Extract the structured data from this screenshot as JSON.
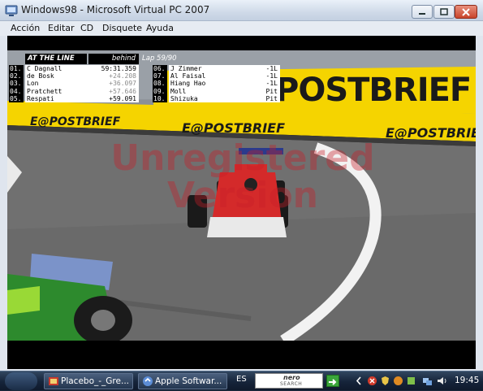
{
  "window": {
    "title": "Windows98 - Microsoft Virtual PC 2007",
    "menu": [
      "Acción",
      "Editar",
      "CD",
      "Disquete",
      "Ayuda"
    ]
  },
  "hud": {
    "header": "AT THE LINE",
    "behind_label": "behind",
    "lap": "Lap 59/90",
    "left_rows": [
      {
        "pos": "01.",
        "name": "C Dagnall",
        "gap": "59:31.359",
        "dim": false
      },
      {
        "pos": "02.",
        "name": "de Bosk",
        "gap": "+24.208",
        "dim": true
      },
      {
        "pos": "03.",
        "name": "Lon",
        "gap": "+36.097",
        "dim": true
      },
      {
        "pos": "04.",
        "name": "Pratchett",
        "gap": "+57.646",
        "dim": true
      },
      {
        "pos": "05.",
        "name": "Respati",
        "gap": "+59.091",
        "dim": false
      }
    ],
    "right_rows": [
      {
        "pos": "06.",
        "name": "J Zimmer",
        "gap": "-1L"
      },
      {
        "pos": "07.",
        "name": "Al Faisal",
        "gap": "-1L"
      },
      {
        "pos": "08.",
        "name": "Hiang Hao",
        "gap": "-1L"
      },
      {
        "pos": "09.",
        "name": "Moll",
        "gap": "Pit"
      },
      {
        "pos": "10.",
        "name": "Shizuka",
        "gap": "Pit"
      }
    ]
  },
  "scene": {
    "banners": [
      "E@POSTBRIEF",
      "E@POSTBRIEF",
      "E@POSTBRIEF",
      "POSTBRIEF"
    ],
    "watermark_line1": "Unregistered",
    "watermark_line2": "Version"
  },
  "taskbar": {
    "buttons": [
      "Placebo_-_Gre...",
      "Apple Softwar..."
    ],
    "language": "ES",
    "search_brand": "nero",
    "search_sub": "SEARCH",
    "clock": "19:45"
  },
  "colors": {
    "banner_yellow": "#f5d400",
    "asphalt": "#6e6e6e",
    "car_red": "#d42a2a",
    "accent_taskbar": "#16243a"
  }
}
